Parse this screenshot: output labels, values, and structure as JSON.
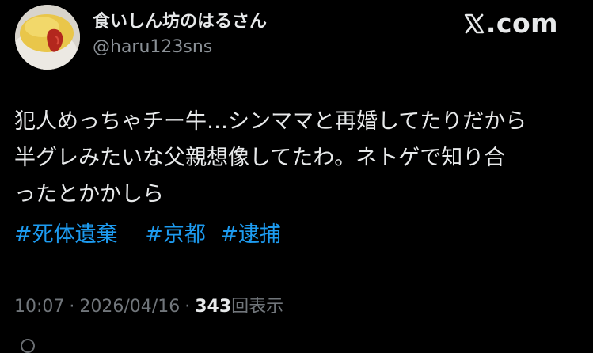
{
  "post": {
    "author": {
      "display_name": "食いしん坊のはるさん",
      "handle": "@haru123sns",
      "avatar_icon": "omelette-rice-avatar-icon"
    },
    "source": {
      "brand_glyph": "x-logo-icon",
      "label": ".com"
    },
    "body_lines": [
      "犯人めっちゃチー牛…シンママと再婚してたりだから",
      "半グレみたいな父親想像してたわ。ネトゲで知り合",
      "ったとかかしら"
    ],
    "hashtags": [
      "#死体遺棄",
      "#京都",
      "#逮捕"
    ],
    "meta": {
      "time": "10:07",
      "separator": "·",
      "date": "2026/04/16",
      "views_count": "343",
      "views_label": "回表示"
    }
  },
  "colors": {
    "background": "#000000",
    "text_primary": "#e7e9ea",
    "text_secondary": "#71767b",
    "link": "#1d9bf0"
  }
}
